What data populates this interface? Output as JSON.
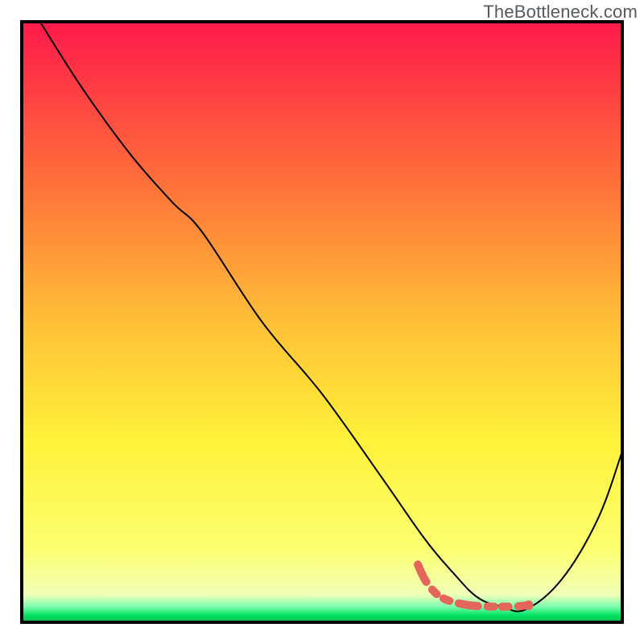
{
  "watermark": "TheBottleneck.com",
  "chart_data": {
    "type": "line",
    "title": "",
    "xlabel": "",
    "ylabel": "",
    "xlim": [
      0,
      100
    ],
    "ylim": [
      0,
      100
    ],
    "background_gradient_stops": [
      {
        "offset": 0.0,
        "color": "#ff1a4b"
      },
      {
        "offset": 0.25,
        "color": "#ff6a3a"
      },
      {
        "offset": 0.5,
        "color": "#ffc037"
      },
      {
        "offset": 0.7,
        "color": "#fff23a"
      },
      {
        "offset": 0.88,
        "color": "#fcff70"
      },
      {
        "offset": 0.955,
        "color": "#f2ffb8"
      },
      {
        "offset": 0.975,
        "color": "#7dffb0"
      },
      {
        "offset": 0.99,
        "color": "#00e060"
      },
      {
        "offset": 1.0,
        "color": "#00c050"
      }
    ],
    "series": [
      {
        "name": "black-curve",
        "color": "#000000",
        "stroke_width": 2,
        "x": [
          3.0,
          10.0,
          18.0,
          25.0,
          30.0,
          40.0,
          50.0,
          60.0,
          67.0,
          72.0,
          76.0,
          80.0,
          84.0,
          90.0,
          96.0,
          100.0
        ],
        "y": [
          100.0,
          89.0,
          78.0,
          70.0,
          65.0,
          50.0,
          38.0,
          24.0,
          14.0,
          8.0,
          4.0,
          2.5,
          2.0,
          7.0,
          17.0,
          28.0
        ]
      },
      {
        "name": "red-dotted-segment",
        "color": "#e4655a",
        "stroke_width": 10,
        "style": "dashed",
        "x": [
          66.0,
          67.5,
          70.0,
          74.0,
          78.0,
          82.0,
          84.5
        ],
        "y": [
          9.5,
          6.5,
          4.0,
          2.8,
          2.5,
          2.5,
          2.7
        ]
      }
    ],
    "marker": {
      "name": "red-dot",
      "x": 84.5,
      "y": 2.7,
      "r": 6,
      "color": "#e4655a"
    }
  }
}
